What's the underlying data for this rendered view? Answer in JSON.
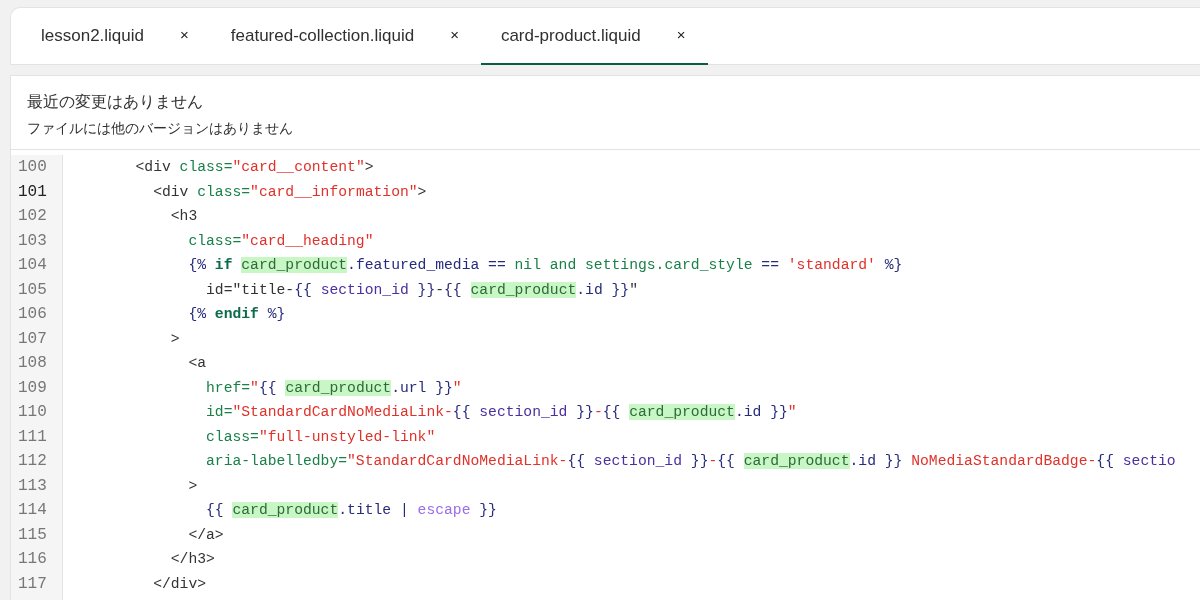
{
  "tabs": [
    {
      "label": "lesson2.liquid",
      "close": "×",
      "selected": false
    },
    {
      "label": "featured-collection.liquid",
      "close": "×",
      "selected": false
    },
    {
      "label": "card-product.liquid",
      "close": "×",
      "selected": true
    }
  ],
  "history": {
    "title": "最近の変更はありません",
    "subtitle": "ファイルには他のバージョンはありません"
  },
  "editor": {
    "lines": [
      {
        "number": "100",
        "current": false,
        "tokens": [
          {
            "kind": "plain",
            "text": "        <div "
          },
          {
            "kind": "attr",
            "text": "class="
          },
          {
            "kind": "str",
            "text": "\"card__content\""
          },
          {
            "kind": "plain",
            "text": ">"
          }
        ]
      },
      {
        "number": "101",
        "current": true,
        "tokens": [
          {
            "kind": "plain",
            "text": "          <div "
          },
          {
            "kind": "attr",
            "text": "class="
          },
          {
            "kind": "str",
            "text": "\"card__information\""
          },
          {
            "kind": "plain",
            "text": ">"
          }
        ]
      },
      {
        "number": "102",
        "current": false,
        "tokens": [
          {
            "kind": "plain",
            "text": "            <h3"
          }
        ]
      },
      {
        "number": "103",
        "current": false,
        "tokens": [
          {
            "kind": "attr",
            "text": "              class="
          },
          {
            "kind": "str",
            "text": "\"card__heading\""
          }
        ]
      },
      {
        "number": "104",
        "current": false,
        "tokens": [
          {
            "kind": "liquid",
            "text": "              {% "
          },
          {
            "kind": "kw",
            "text": "if "
          },
          {
            "kind": "match",
            "text": "card_product"
          },
          {
            "kind": "liquid",
            "text": ".featured_media == "
          },
          {
            "kind": "attr",
            "text": "nil and settings.card_style"
          },
          {
            "kind": "liquid",
            "text": " == "
          },
          {
            "kind": "str",
            "text": "'standard'"
          },
          {
            "kind": "liquid",
            "text": " %}"
          }
        ]
      },
      {
        "number": "105",
        "current": false,
        "tokens": [
          {
            "kind": "plain",
            "text": "                id=\"title-"
          },
          {
            "kind": "liquid",
            "text": "{{ "
          },
          {
            "kind": "var",
            "text": "section_id"
          },
          {
            "kind": "liquid",
            "text": " }}"
          },
          {
            "kind": "plain",
            "text": "-"
          },
          {
            "kind": "liquid",
            "text": "{{ "
          },
          {
            "kind": "match",
            "text": "card_product"
          },
          {
            "kind": "liquid",
            "text": ".id }}"
          },
          {
            "kind": "plain",
            "text": "\""
          }
        ]
      },
      {
        "number": "106",
        "current": false,
        "tokens": [
          {
            "kind": "liquid",
            "text": "              {% "
          },
          {
            "kind": "kw",
            "text": "endif"
          },
          {
            "kind": "liquid",
            "text": " %}"
          }
        ]
      },
      {
        "number": "107",
        "current": false,
        "tokens": [
          {
            "kind": "plain",
            "text": "            >"
          }
        ]
      },
      {
        "number": "108",
        "current": false,
        "tokens": [
          {
            "kind": "plain",
            "text": "              <a"
          }
        ]
      },
      {
        "number": "109",
        "current": false,
        "tokens": [
          {
            "kind": "attr",
            "text": "                href="
          },
          {
            "kind": "str",
            "text": "\""
          },
          {
            "kind": "liquid",
            "text": "{{ "
          },
          {
            "kind": "match",
            "text": "card_product"
          },
          {
            "kind": "liquid",
            "text": ".url }}"
          },
          {
            "kind": "str",
            "text": "\""
          }
        ]
      },
      {
        "number": "110",
        "current": false,
        "tokens": [
          {
            "kind": "attr",
            "text": "                id="
          },
          {
            "kind": "str",
            "text": "\"StandardCardNoMediaLink-"
          },
          {
            "kind": "liquid",
            "text": "{{ "
          },
          {
            "kind": "var",
            "text": "section_id"
          },
          {
            "kind": "liquid",
            "text": " }}"
          },
          {
            "kind": "str",
            "text": "-"
          },
          {
            "kind": "liquid",
            "text": "{{ "
          },
          {
            "kind": "match",
            "text": "card_product"
          },
          {
            "kind": "liquid",
            "text": ".id }}"
          },
          {
            "kind": "str",
            "text": "\""
          }
        ]
      },
      {
        "number": "111",
        "current": false,
        "tokens": [
          {
            "kind": "attr",
            "text": "                class="
          },
          {
            "kind": "str",
            "text": "\"full-unstyled-link\""
          }
        ]
      },
      {
        "number": "112",
        "current": false,
        "tokens": [
          {
            "kind": "attr",
            "text": "                aria-labelledby="
          },
          {
            "kind": "str",
            "text": "\"StandardCardNoMediaLink-"
          },
          {
            "kind": "liquid",
            "text": "{{ "
          },
          {
            "kind": "var",
            "text": "section_id"
          },
          {
            "kind": "liquid",
            "text": " }}"
          },
          {
            "kind": "str",
            "text": "-"
          },
          {
            "kind": "liquid",
            "text": "{{ "
          },
          {
            "kind": "match",
            "text": "card_product"
          },
          {
            "kind": "liquid",
            "text": ".id }}"
          },
          {
            "kind": "str",
            "text": " NoMediaStandardBadge-"
          },
          {
            "kind": "liquid",
            "text": "{{ "
          },
          {
            "kind": "var",
            "text": "sectio"
          }
        ]
      },
      {
        "number": "113",
        "current": false,
        "tokens": [
          {
            "kind": "plain",
            "text": "              >"
          }
        ]
      },
      {
        "number": "114",
        "current": false,
        "tokens": [
          {
            "kind": "liquid",
            "text": "                {{ "
          },
          {
            "kind": "match",
            "text": "card_product"
          },
          {
            "kind": "liquid",
            "text": ".title | "
          },
          {
            "kind": "filter",
            "text": "escape"
          },
          {
            "kind": "liquid",
            "text": " }}"
          }
        ]
      },
      {
        "number": "115",
        "current": false,
        "tokens": [
          {
            "kind": "plain",
            "text": "              </a>"
          }
        ]
      },
      {
        "number": "116",
        "current": false,
        "tokens": [
          {
            "kind": "plain",
            "text": "            </h3>"
          }
        ]
      },
      {
        "number": "117",
        "current": false,
        "tokens": [
          {
            "kind": "plain",
            "text": "          </div>"
          }
        ]
      }
    ]
  }
}
